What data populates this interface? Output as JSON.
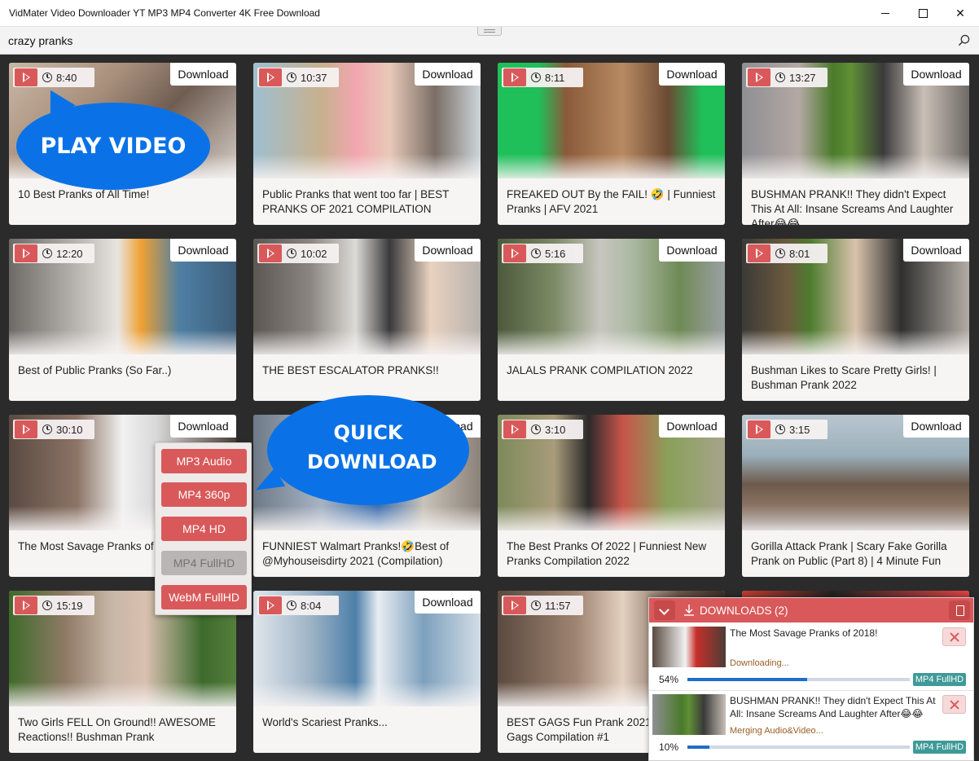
{
  "window": {
    "title": "VidMater Video Downloader YT MP3 MP4 Converter 4K Free Download",
    "minimize_glyph": "",
    "close_glyph": "✕"
  },
  "search": {
    "value": "crazy pranks",
    "placeholder": ""
  },
  "download_label": "Download",
  "callouts": {
    "play": "PLAY VIDEO",
    "quick": "QUICK DOWNLOAD"
  },
  "videos": [
    {
      "duration": "8:40",
      "title": "10 Best Pranks of All Time!"
    },
    {
      "duration": "10:37",
      "title": "Public Pranks that went too far | BEST PRANKS OF 2021 COMPILATION"
    },
    {
      "duration": "8:11",
      "title": "FREAKED OUT By the FAIL! 🤣 | Funniest Pranks | AFV 2021"
    },
    {
      "duration": "13:27",
      "title": "BUSHMAN PRANK!! They didn't Expect This At All: Insane Screams And Laughter After😂😂"
    },
    {
      "duration": "12:20",
      "title": "Best of Public Pranks (So Far..)"
    },
    {
      "duration": "10:02",
      "title": "THE BEST ESCALATOR PRANKS!!"
    },
    {
      "duration": "5:16",
      "title": "JALALS PRANK COMPILATION 2022"
    },
    {
      "duration": "8:01",
      "title": "Bushman Likes to Scare Pretty Girls! | Bushman Prank 2022"
    },
    {
      "duration": "30:10",
      "title": "The Most Savage Pranks of"
    },
    {
      "duration": "",
      "title": "FUNNIEST Walmart Pranks!🤣Best of @Myhouseisdirty 2021 (Compilation)"
    },
    {
      "duration": "3:10",
      "title": "The Best Pranks Of 2022 | Funniest New Pranks Compilation 2022"
    },
    {
      "duration": "3:15",
      "title": "Gorilla Attack Prank | Scary Fake Gorilla Prank on Public (Part 8) | 4 Minute Fun"
    },
    {
      "duration": "15:19",
      "title": "Two Girls FELL On Ground!! AWESOME Reactions!! Bushman Prank"
    },
    {
      "duration": "8:04",
      "title": "World's Scariest Pranks..."
    },
    {
      "duration": "11:57",
      "title": "BEST GAGS Fun Prank 2021 | Laughs Gags Compilation #1"
    }
  ],
  "quick_menu": [
    "MP3 Audio",
    "MP4 360p",
    "MP4 HD",
    "MP4 FullHD",
    "WebM FullHD"
  ],
  "downloads_panel": {
    "label": "DOWNLOADS",
    "count": "(2)",
    "items": [
      {
        "title": "The Most Savage Pranks of 2018!",
        "status": "Downloading...",
        "percent_label": "54%",
        "progress": 0.54,
        "format": "MP4 FullHD"
      },
      {
        "title": "BUSHMAN PRANK!! They didn't Expect This At All: Insane Screams And Laughter After😂😂",
        "status": "Merging Audio&Video...",
        "percent_label": "10%",
        "progress": 0.1,
        "format": "MP4 FullHD"
      }
    ]
  },
  "colors": {
    "accent": "#d9595a",
    "callout": "#0a72e6",
    "format_badge": "#3e9a98",
    "progress": "#1d6fc9"
  }
}
